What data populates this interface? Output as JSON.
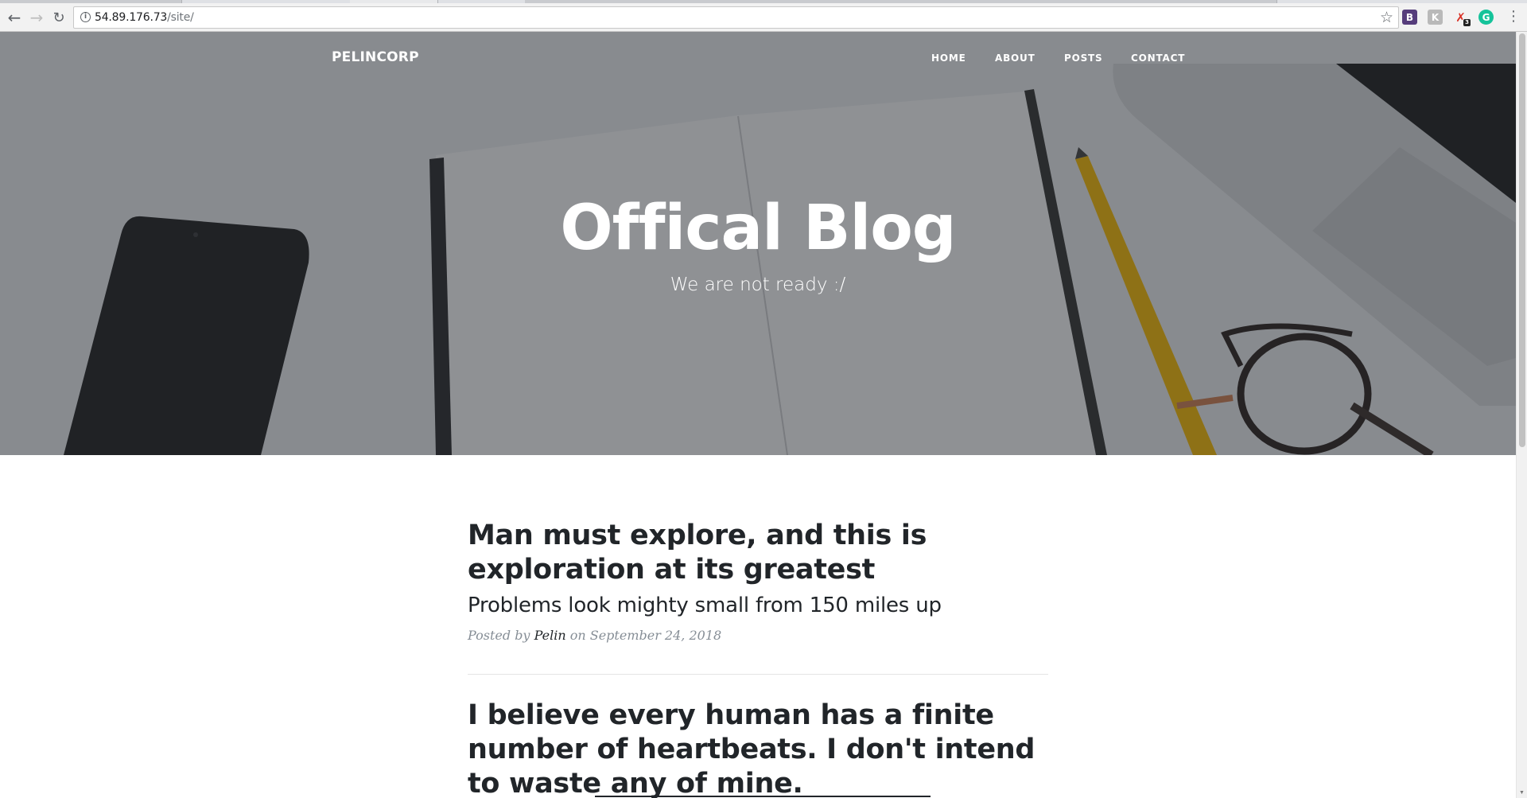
{
  "browser": {
    "url_host": "54.89.176.73",
    "url_path": "/site/",
    "icons": {
      "back": "arrow-left-icon",
      "forward": "arrow-right-icon",
      "reload": "reload-icon",
      "info": "info-icon",
      "bookmark": "star-icon",
      "menu": "kebab-menu-icon"
    },
    "extensions": [
      {
        "name": "bootstrap-extension",
        "label": "B",
        "color": "#563d7c"
      },
      {
        "name": "k-extension",
        "label": "K",
        "color": "#b9b9b9"
      },
      {
        "name": "red-extension",
        "label": "✇",
        "badge": "3",
        "color": "#d93025"
      },
      {
        "name": "grammarly-extension",
        "label": "G",
        "color": "#15c39a"
      }
    ]
  },
  "navbar": {
    "brand": "PELINCORP",
    "links": [
      "HOME",
      "ABOUT",
      "POSTS",
      "CONTACT"
    ]
  },
  "hero": {
    "title": "Offical Blog",
    "subtitle": "We are not ready :/"
  },
  "posts": [
    {
      "title": "Man must explore, and this is exploration at its greatest",
      "subtitle": "Problems look mighty small from 150 miles up",
      "meta_prefix": "Posted by",
      "author": "Pelin",
      "meta_date": "on September 24, 2018"
    },
    {
      "title": "I believe every human has a finite number of heartbeats. I don't intend to waste any of mine."
    }
  ],
  "colors": {
    "text_dark": "#212529",
    "meta_gray": "#868e96",
    "overlay": "rgba(33,37,41,0.48)"
  }
}
